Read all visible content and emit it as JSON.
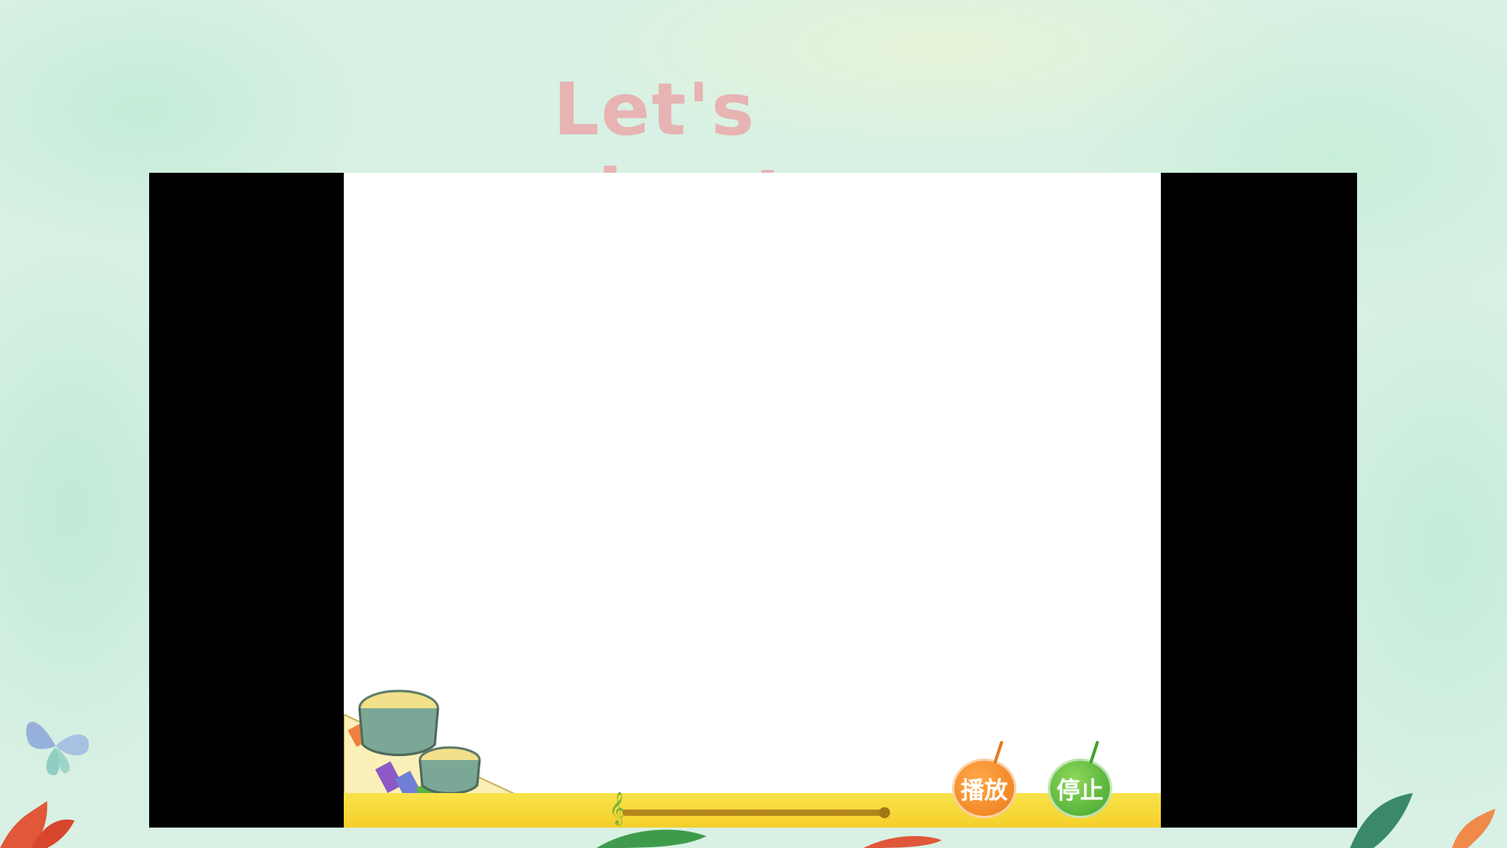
{
  "slide": {
    "title": "Let's chant"
  },
  "player": {
    "play_label": "播放",
    "stop_label": "停止",
    "clef_icon": "treble-clef-icon",
    "progress": 0.0
  },
  "decor": {
    "butterfly": "butterfly-icon",
    "instruments": "drum-and-xylophone-illustration",
    "leaves": "leaves-illustration"
  },
  "colors": {
    "title": "#e7b3b3",
    "background": "#d8f1e4",
    "play_button": "#ec7b17",
    "stop_button": "#3fa52b",
    "control_bar": "#f5cf2b"
  }
}
